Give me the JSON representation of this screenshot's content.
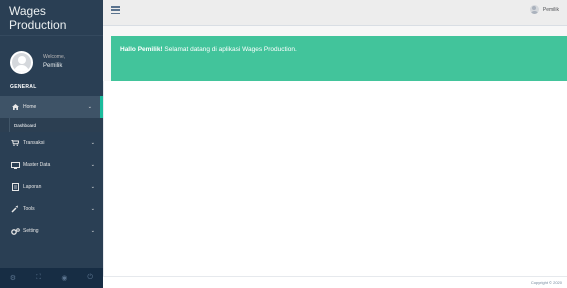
{
  "app": {
    "title": "Wages Production"
  },
  "profile": {
    "welcome": "Welcome,",
    "name": "Pemilik"
  },
  "sidebar": {
    "section": "GENERAL",
    "items": [
      {
        "label": "Home",
        "icon": "home-icon"
      },
      {
        "label": "Transaksi",
        "icon": "cart-icon"
      },
      {
        "label": "Master Data",
        "icon": "desktop-icon"
      },
      {
        "label": "Laporan",
        "icon": "document-icon"
      },
      {
        "label": "Tools",
        "icon": "wrench-icon"
      },
      {
        "label": "Setting",
        "icon": "cogs-icon"
      }
    ],
    "home_submenu": [
      {
        "label": "Dashboard"
      }
    ],
    "footer_icons": [
      "gear-icon",
      "fullscreen-icon",
      "eye-icon",
      "power-icon"
    ]
  },
  "topnav": {
    "user": "Pemilik"
  },
  "alert": {
    "bold": "Hallo Pemilik!",
    "text": " Selamat datang di aplikasi Wages Production."
  },
  "footer": {
    "text": "Copyright © 2020"
  },
  "colors": {
    "sidebar": "#2a3f54",
    "alert": "#42c49b",
    "accent": "#1abb9c"
  }
}
